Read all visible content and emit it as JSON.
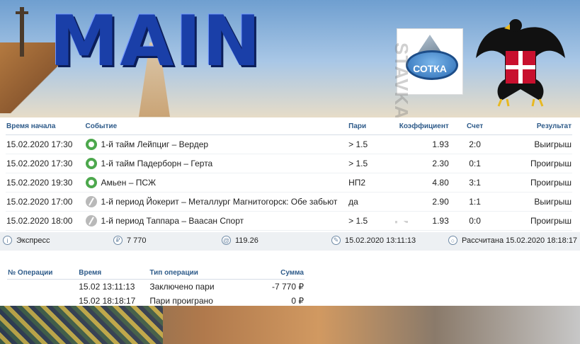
{
  "header": {
    "title": "MAIN",
    "logo_text": "СОТКА"
  },
  "watermark": "STAVKA-PROGNOZ",
  "bets_table": {
    "columns": [
      "Время начала",
      "Событие",
      "Пари",
      "Коэффициент",
      "Счет",
      "Результат"
    ],
    "rows": [
      {
        "time": "15.02.2020 17:30",
        "sport_icon": "football-icon",
        "event": "1-й тайм Лейпциг – Вердер",
        "bet": "> 1.5",
        "coef": "1.93",
        "score": "2:0",
        "result": "Выигрыш"
      },
      {
        "time": "15.02.2020 17:30",
        "sport_icon": "football-icon",
        "event": "1-й тайм Падерборн – Герта",
        "bet": "> 1.5",
        "coef": "2.30",
        "score": "0:1",
        "result": "Проигрыш"
      },
      {
        "time": "15.02.2020 19:30",
        "sport_icon": "football-icon",
        "event": "Амьен – ПСЖ",
        "bet": "НП2",
        "coef": "4.80",
        "score": "3:1",
        "result": "Проигрыш"
      },
      {
        "time": "15.02.2020 17:00",
        "sport_icon": "hockey-icon",
        "event": "1-й период Йокерит – Металлург Магнитогорск: Обе забьют",
        "bet": "да",
        "coef": "2.90",
        "score": "1:1",
        "result": "Выигрыш"
      },
      {
        "time": "15.02.2020 18:00",
        "sport_icon": "hockey-icon",
        "event": "1-й период Таппара – Ваасан Спорт",
        "bet": "> 1.5",
        "coef": "1.93",
        "score": "0:0",
        "result": "Проигрыш"
      }
    ]
  },
  "summary": {
    "type_icon": "i",
    "type": "Экспресс",
    "amount_icon": "₽",
    "amount": "7 770",
    "odds_icon": "@",
    "odds": "119.26",
    "date_icon": "✎",
    "date": "15.02.2020 13:11:13",
    "status_icon": "○",
    "status": "Рассчитана 15.02.2020 18:18:17"
  },
  "operations": {
    "columns": [
      "№ Операции",
      "Время",
      "Тип операции",
      "Сумма"
    ],
    "rows": [
      {
        "num": "",
        "time": "15.02 13:11:13",
        "type": "Заключено пари",
        "sum": "-7 770 ₽"
      },
      {
        "num": "",
        "time": "15.02 18:18:17",
        "type": "Пари проиграно",
        "sum": "0 ₽"
      }
    ]
  }
}
